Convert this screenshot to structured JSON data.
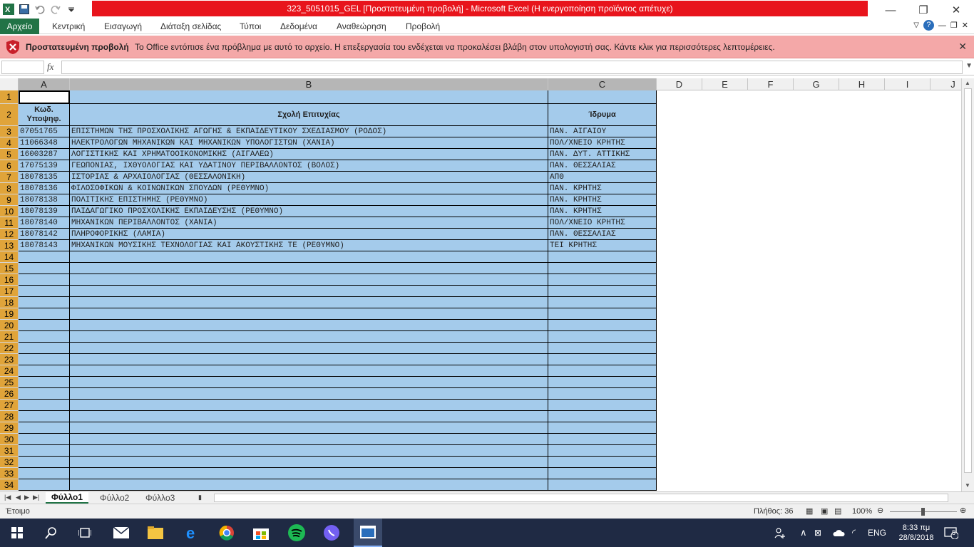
{
  "window": {
    "title": "323_5051015_GEL  [Προστατευμένη προβολή]  -  Microsoft Excel (Η ενεργοποίηση προϊόντος απέτυχε)"
  },
  "ribbon": {
    "tabs": [
      "Αρχείο",
      "Κεντρική",
      "Εισαγωγή",
      "Διάταξη σελίδας",
      "Τύποι",
      "Δεδομένα",
      "Αναθεώρηση",
      "Προβολή"
    ]
  },
  "protected_view": {
    "title": "Προστατευμένη προβολή",
    "message": "Το Office εντόπισε ένα πρόβλημα με αυτό το αρχείο. Η επεξεργασία του ενδέχεται να προκαλέσει βλάβη στον υπολογιστή σας. Κάντε κλικ για περισσότερες λεπτομέρειες."
  },
  "formula_bar": {
    "name_box": "",
    "fx": "fx",
    "formula": ""
  },
  "columns": [
    "A",
    "B",
    "C",
    "D",
    "E",
    "F",
    "G",
    "H",
    "I",
    "J"
  ],
  "header_row": {
    "a": "Κωδ. Υποψηφ.",
    "b": "Σχολή Επιτυχίας",
    "c": "Ίδρυμα"
  },
  "data_rows": [
    {
      "code": "07051765",
      "school": "ΕΠΙΣΤΗΜΩΝ ΤΗΣ ΠΡΟΣΧΟΛΙΚΗΣ ΑΓΩΓΗΣ & ΕΚΠΑΙΔΕΥΤΙΚΟΥ ΣΧΕΔΙΑΣΜΟΥ (ΡΟΔΟΣ)",
      "inst": "ΠΑΝ. ΑΙΓΑΙΟΥ"
    },
    {
      "code": "11066348",
      "school": "ΗΛΕΚΤΡΟΛΟΓΩΝ ΜΗΧΑΝΙΚΩΝ ΚΑΙ ΜΗΧΑΝΙΚΩΝ ΥΠΟΛΟΓΙΣΤΩΝ (ΧΑΝΙΑ)",
      "inst": "ΠΟΛ/ΧΝΕΙΟ ΚΡΗΤΗΣ"
    },
    {
      "code": "16003287",
      "school": "ΛΟΓΙΣΤΙΚΗΣ ΚΑΙ ΧΡΗΜΑΤΟΟΙΚΟΝΟΜΙΚΗΣ (ΑΙΓΑΛΕΩ)",
      "inst": "ΠΑΝ. ΔΥΤ. ΑΤΤΙΚΗΣ"
    },
    {
      "code": "17075139",
      "school": "ΓΕΩΠΟΝΙΑΣ, ΙΧΘΥΟΛΟΓΙΑΣ ΚΑΙ ΥΔΑΤΙΝΟΥ ΠΕΡΙΒΑΛΛΟΝΤΟΣ (ΒΟΛΟΣ)",
      "inst": "ΠΑΝ. ΘΕΣΣΑΛΙΑΣ"
    },
    {
      "code": "18078135",
      "school": "ΙΣΤΟΡΙΑΣ & ΑΡΧΑΙΟΛΟΓΙΑΣ (ΘΕΣΣΑΛΟΝΙΚΗ)",
      "inst": "ΑΠΘ"
    },
    {
      "code": "18078136",
      "school": "ΦΙΛΟΣΟΦΙΚΩΝ & ΚΟΙΝΩΝΙΚΩΝ ΣΠΟΥΔΩΝ (ΡΕΘΥΜΝΟ)",
      "inst": "ΠΑΝ. ΚΡΗΤΗΣ"
    },
    {
      "code": "18078138",
      "school": "ΠΟΛΙΤΙΚΗΣ ΕΠΙΣΤΗΜΗΣ (ΡΕΘΥΜΝΟ)",
      "inst": "ΠΑΝ. ΚΡΗΤΗΣ"
    },
    {
      "code": "18078139",
      "school": "ΠΑΙΔΑΓΩΓΙΚΟ ΠΡΟΣΧΟΛΙΚΗΣ ΕΚΠΑΙΔΕΥΣΗΣ (ΡΕΘΥΜΝΟ)",
      "inst": "ΠΑΝ. ΚΡΗΤΗΣ"
    },
    {
      "code": "18078140",
      "school": "ΜΗΧΑΝΙΚΩΝ ΠΕΡΙΒΑΛΛΟΝΤΟΣ (ΧΑΝΙΑ)",
      "inst": "ΠΟΛ/ΧΝΕΙΟ ΚΡΗΤΗΣ"
    },
    {
      "code": "18078142",
      "school": "ΠΛΗΡΟΦΟΡΙΚΗΣ (ΛΑΜΙΑ)",
      "inst": "ΠΑΝ. ΘΕΣΣΑΛΙΑΣ"
    },
    {
      "code": "18078143",
      "school": "ΜΗΧΑΝΙΚΩΝ ΜΟΥΣΙΚΗΣ ΤΕΧΝΟΛΟΓΙΑΣ ΚΑΙ ΑΚΟΥΣΤΙΚΗΣ ΤΕ (ΡΕΘΥΜΝΟ)",
      "inst": "ΤΕΙ ΚΡΗΤΗΣ"
    }
  ],
  "empty_row_numbers": [
    "14",
    "15",
    "16",
    "17",
    "18",
    "19",
    "20",
    "21",
    "22",
    "23",
    "24",
    "25",
    "26",
    "27",
    "28",
    "29",
    "30",
    "31",
    "32",
    "33",
    "34"
  ],
  "sheets": [
    "Φύλλο1",
    "Φύλλο2",
    "Φύλλο3"
  ],
  "status": {
    "ready": "Έτοιμο",
    "count": "Πλήθος: 36",
    "zoom": "100%"
  },
  "taskbar": {
    "lang": "ENG",
    "time": "8:33 πμ",
    "date": "28/8/2018",
    "notifications": "5"
  },
  "colors": {
    "excel_green": "#217346",
    "title_red": "#e8141c",
    "protected_bar": "#f4a8a8",
    "selection": "#a4cbeb"
  }
}
